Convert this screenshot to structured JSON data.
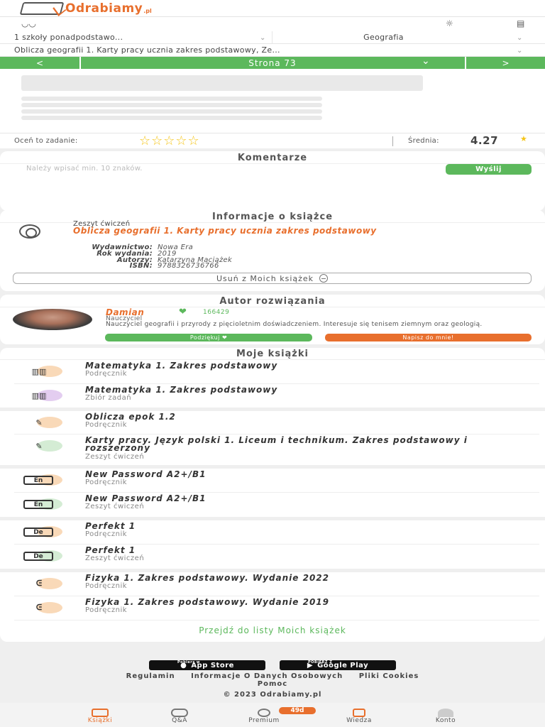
{
  "app": {
    "logo_text": "Odrabiamy",
    "logo_suffix": ".pl"
  },
  "filters": {
    "school_level": "1 szkoły ponadpodstawo...",
    "subject": "Geografia",
    "book": "Oblicza geografii 1. Karty pracy ucznia zakres podstawowy, Ze..."
  },
  "pager": {
    "prev": "<",
    "page_label": "Strona 73",
    "dropdown": "⌄",
    "next": ">"
  },
  "rating": {
    "label": "Oceń to zadanie:",
    "stars": "☆☆☆☆☆",
    "avg_label": "Średnia:",
    "avg_value": "4.27",
    "avg_star": "★",
    "avg_value_num": 4.27
  },
  "comments": {
    "title": "Komentarze",
    "placeholder": "Należy wpisać min. 10 znaków.",
    "send": "Wyślij"
  },
  "book_info": {
    "title": "Informacje o książce",
    "type": "Zeszyt ćwiczeń",
    "book_title": "Oblicza geografii 1. Karty pracy ucznia zakres podstawowy",
    "meta": [
      {
        "key": "Wydawnictwo:",
        "value": "Nowa Era"
      },
      {
        "key": "Rok wydania:",
        "value": "2019"
      },
      {
        "key": "Autorzy:",
        "value": "Katarzyna Maciążek"
      },
      {
        "key": "ISBN:",
        "value": "9788326736766"
      }
    ],
    "remove_button": "Usuń z Moich książek"
  },
  "author": {
    "title": "Autor rozwiązania",
    "name": "Damian",
    "points": "166429",
    "role": "Nauczyciel",
    "bio": "Nauczyciel geografii i przyrody z pięcioletnim doświadczeniem. Interesuje się tenisem ziemnym oraz geologią.",
    "thanks_button": "Podziękuj ❤",
    "write_button": "Napisz do mnie!"
  },
  "my_books": {
    "title": "Moje książki",
    "items": [
      {
        "title": "Matematyka 1. Zakres podstawowy",
        "subtitle": "Podręcznik",
        "icon": "abacus-icon",
        "accent": "#f9d9b8"
      },
      {
        "title": "Matematyka 1. Zakres podstawowy",
        "subtitle": "Zbiór zadań",
        "icon": "abacus-icon",
        "accent": "#e3cdf0"
      },
      {
        "title": "Oblicza epok 1.2",
        "subtitle": "Podręcznik",
        "icon": "pen-icon",
        "accent": "#f9d9b8"
      },
      {
        "title": "Karty pracy. Język polski 1. Liceum i technikum. Zakres podstawowy i rozszerzony",
        "subtitle": "Zeszyt ćwiczeń",
        "icon": "pen-icon",
        "accent": "#d4ecd4"
      },
      {
        "title": "New Password A2+/B1",
        "subtitle": "Podręcznik",
        "icon": "en-icon",
        "icon_text": "En",
        "accent": "#f9d9b8"
      },
      {
        "title": "New Password A2+/B1",
        "subtitle": "Zeszyt ćwiczeń",
        "icon": "en-icon",
        "icon_text": "En",
        "accent": "#d4ecd4"
      },
      {
        "title": "Perfekt 1",
        "subtitle": "Podręcznik",
        "icon": "de-icon",
        "icon_text": "De",
        "accent": "#f9d9b8"
      },
      {
        "title": "Perfekt 1",
        "subtitle": "Zeszyt ćwiczeń",
        "icon": "de-icon",
        "icon_text": "De",
        "accent": "#d4ecd4"
      },
      {
        "title": "Fizyka 1. Zakres podstawowy. Wydanie 2022",
        "subtitle": "Podręcznik",
        "icon": "magnet-icon",
        "accent": "#f9d9b8"
      },
      {
        "title": "Fizyka 1. Zakres podstawowy. Wydanie 2019",
        "subtitle": "Podręcznik",
        "icon": "magnet-icon",
        "accent": "#f9d9b8"
      }
    ],
    "list_link": "Przejdź do listy Moich książek"
  },
  "footer": {
    "app_store_small": "Pobierz w",
    "app_store": "App Store",
    "google_play_small": "POBIERZ Z",
    "google_play": "Google Play",
    "links": [
      "Regulamin",
      "Informacje O Danych Osobowych",
      "Pliki Cookies"
    ],
    "help": "Pomoc",
    "copyright": "© 2023 Odrabiamy.pl"
  },
  "nav": {
    "items": [
      {
        "label": "Książki",
        "icon": "books-icon"
      },
      {
        "label": "Q&A",
        "icon": "chat-icon"
      },
      {
        "label": "Premium",
        "icon": "premium-icon"
      },
      {
        "label": "Wiedza",
        "icon": "knowledge-icon"
      },
      {
        "label": "Konto",
        "icon": "account-icon"
      }
    ],
    "badge": "49d"
  },
  "colors": {
    "accent": "#e86f2d",
    "green": "#5cb85c",
    "star": "#f5c518"
  }
}
